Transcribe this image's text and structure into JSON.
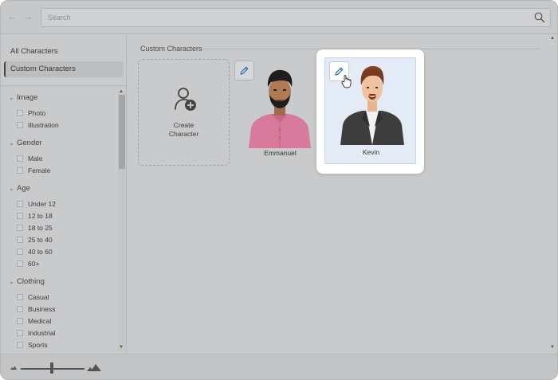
{
  "search": {
    "placeholder": "Search"
  },
  "sidebar": {
    "nav": [
      {
        "label": "All Characters",
        "active": false
      },
      {
        "label": "Custom Characters",
        "active": true
      }
    ],
    "filters": [
      {
        "label": "Image",
        "options": [
          "Photo",
          "Illustration"
        ]
      },
      {
        "label": "Gender",
        "options": [
          "Male",
          "Female"
        ]
      },
      {
        "label": "Age",
        "options": [
          "Under 12",
          "12 to 18",
          "18 to 25",
          "25 to 40",
          "40 to 60",
          "60+"
        ]
      },
      {
        "label": "Clothing",
        "options": [
          "Casual",
          "Business",
          "Medical",
          "Industrial",
          "Sports"
        ]
      }
    ]
  },
  "main": {
    "section_title": "Custom Characters",
    "create_card": {
      "line1": "Create",
      "line2": "Character"
    },
    "characters": [
      {
        "name": "Emmanuel",
        "shirt_color": "#d87a9c"
      },
      {
        "name": "Kevin",
        "jacket_color": "#3d3d3d"
      }
    ]
  },
  "colors": {
    "accent": "#2f6fc0",
    "window_bg": "#c9cacc",
    "highlight_bg": "#e2ebf6"
  },
  "icons": {
    "back": "arrow-left-icon",
    "forward": "arrow-right-icon",
    "search": "search-icon",
    "edit": "pencil-icon",
    "create": "user-plus-icon"
  }
}
